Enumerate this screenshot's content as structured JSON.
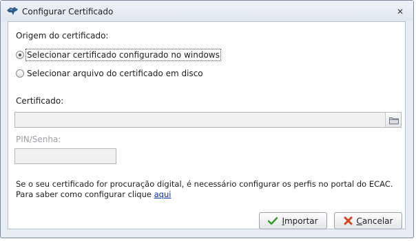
{
  "window": {
    "title": "Configurar Certificado"
  },
  "origin": {
    "label": "Origem do certificado:",
    "options": [
      {
        "label": "Selecionar certificado configurado no windows",
        "checked": true
      },
      {
        "label": "Selecionar arquivo do certificado em disco",
        "checked": false
      }
    ]
  },
  "certificate": {
    "label": "Certificado:",
    "value": ""
  },
  "pin": {
    "label": "PIN/Senha:",
    "value": ""
  },
  "info": {
    "line1": "Se o seu certificado for procuração digital, é necessário configurar os perfis no portal do ECAC.",
    "line2_prefix": "Para saber como configurar clique ",
    "link": "aqui"
  },
  "buttons": {
    "import_mnemonic": "I",
    "import_rest": "mportar",
    "cancel_mnemonic": "C",
    "cancel_rest": "ancelar"
  },
  "colors": {
    "import_icon": "#3a9a2a",
    "cancel_icon": "#d9431f"
  }
}
